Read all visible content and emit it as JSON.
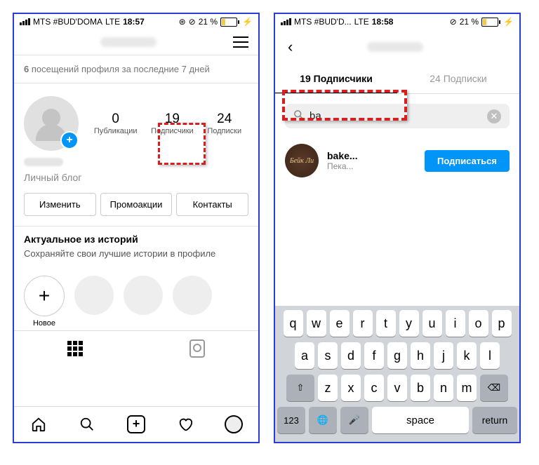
{
  "left": {
    "status": {
      "carrier": "MTS #BUD'DOMA",
      "net": "LTE",
      "time": "18:57",
      "battery": "21 %"
    },
    "visits_prefix": "6",
    "visits_text": " посещений профиля за последние 7 дней",
    "stats": {
      "posts": {
        "n": "0",
        "l": "Публикации"
      },
      "followers": {
        "n": "19",
        "l": "Подписчики"
      },
      "following": {
        "n": "24",
        "l": "Подписки"
      }
    },
    "bio_type": "Личный блог",
    "buttons": {
      "edit": "Изменить",
      "promo": "Промоакции",
      "contacts": "Контакты"
    },
    "stories": {
      "title": "Актуальное из историй",
      "sub": "Сохраняйте свои лучшие истории в профиле",
      "new": "Новое"
    }
  },
  "right": {
    "status": {
      "carrier": "MTS #BUD'D...",
      "net": "LTE",
      "time": "18:58",
      "battery": "21 %"
    },
    "tabs": {
      "followers": "19 Подписчики",
      "following": "24 Подписки"
    },
    "search_value": "ba",
    "result": {
      "avatar_text": "Бейк Ли",
      "name": "bake...",
      "sub": "Пека...",
      "follow": "Подписаться"
    },
    "kb": {
      "r1": [
        "q",
        "w",
        "e",
        "r",
        "t",
        "y",
        "u",
        "i",
        "o",
        "p"
      ],
      "r2": [
        "a",
        "s",
        "d",
        "f",
        "g",
        "h",
        "j",
        "k",
        "l"
      ],
      "r3": [
        "z",
        "x",
        "c",
        "v",
        "b",
        "n",
        "m"
      ],
      "num": "123",
      "space": "space",
      "ret": "return"
    }
  }
}
